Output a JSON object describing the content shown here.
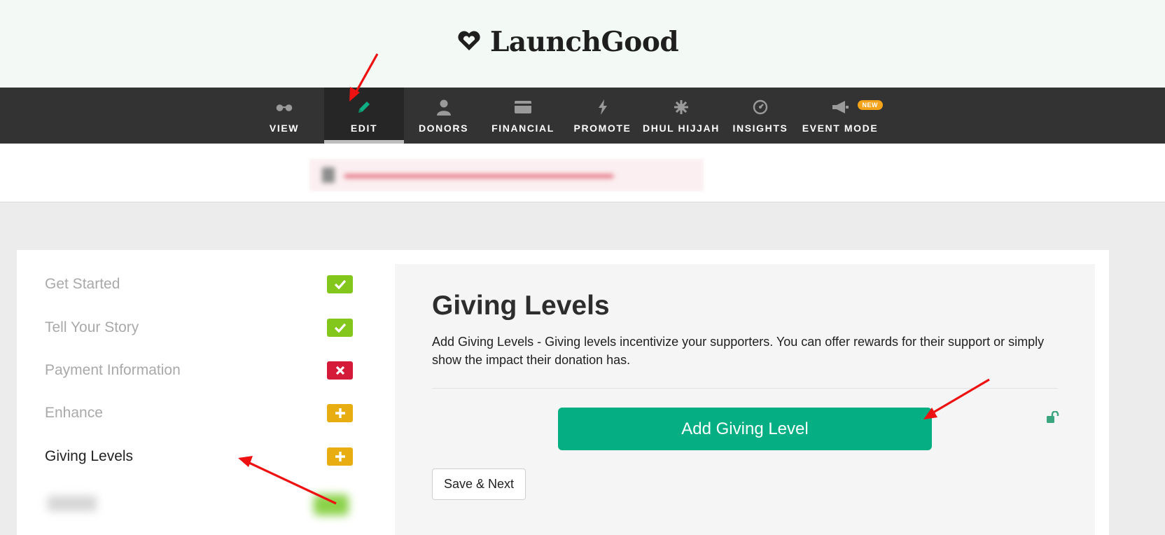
{
  "brand": {
    "name": "LaunchGood"
  },
  "nav": {
    "items": [
      {
        "label": "VIEW",
        "icon": "glasses-icon",
        "active": false
      },
      {
        "label": "EDIT",
        "icon": "pencil-icon",
        "active": true
      },
      {
        "label": "DONORS",
        "icon": "person-icon",
        "active": false
      },
      {
        "label": "FINANCIAL",
        "icon": "credit-card-icon",
        "active": false
      },
      {
        "label": "PROMOTE",
        "icon": "lightning-icon",
        "active": false
      },
      {
        "label": "DHUL HIJJAH",
        "icon": "starburst-icon",
        "active": false
      },
      {
        "label": "INSIGHTS",
        "icon": "gauge-icon",
        "active": false
      },
      {
        "label": "EVENT MODE",
        "icon": "megaphone-icon",
        "active": false,
        "badge": "NEW"
      }
    ]
  },
  "sidebar": {
    "steps": [
      {
        "label": "Get Started",
        "status": "complete",
        "icon": "check-icon"
      },
      {
        "label": "Tell Your Story",
        "status": "complete",
        "icon": "check-icon"
      },
      {
        "label": "Payment Information",
        "status": "error",
        "icon": "x-icon"
      },
      {
        "label": "Enhance",
        "status": "add",
        "icon": "plus-icon"
      },
      {
        "label": "Giving Levels",
        "status": "add",
        "icon": "plus-icon",
        "current": true
      }
    ]
  },
  "main": {
    "title": "Giving Levels",
    "description": "Add Giving Levels - Giving levels incentivize your supporters. You can offer rewards for their support or simply show the impact their donation has.",
    "add_button": "Add Giving Level",
    "save_button": "Save & Next"
  },
  "colors": {
    "nav_bg": "#333333",
    "accent_green": "#05ae83",
    "status_complete": "#83c61c",
    "status_error": "#d51a39",
    "status_add": "#e8ad10",
    "badge_new": "#f5a31a",
    "annotation_red": "#ee1111"
  }
}
